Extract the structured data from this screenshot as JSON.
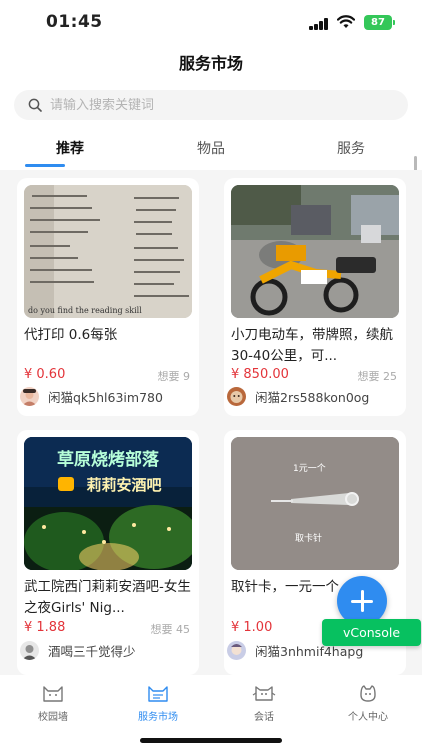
{
  "status_bar": {
    "time": "01:45",
    "battery": "87"
  },
  "header": {
    "title": "服务市场"
  },
  "search": {
    "placeholder": "请输入搜索关键词"
  },
  "tabs": [
    {
      "label": "推荐",
      "active": true
    },
    {
      "label": "物品",
      "active": false
    },
    {
      "label": "服务",
      "active": false
    }
  ],
  "items": [
    {
      "title": "代打印 0.6每张",
      "price": "¥ 0.60",
      "want": "想要 9",
      "seller": "闲猫qk5hl63im780"
    },
    {
      "title": "小刀电动车，带牌照，续航30-40公里，可...",
      "price": "¥ 850.00",
      "want": "想要 25",
      "seller": "闲猫2rs588kon0og"
    },
    {
      "title": "武工院西门莉莉安酒吧-女生之夜Girls' Nig...",
      "price": "¥ 1.88",
      "want": "想要 45",
      "seller": "酒喝三千觉得少"
    },
    {
      "title": "取针卡，一元一个",
      "price": "¥ 1.00",
      "want": "",
      "seller": "闲猫3nhmif4hapg"
    }
  ],
  "image_text": {
    "sign_line1": "草原烧烤部落",
    "sign_line2": "莉莉安酒吧",
    "photo_label1": "1元一个",
    "photo_label2": "取卡针",
    "book_question": "do you find the reading skill"
  },
  "fab": {
    "icon": "plus-icon"
  },
  "vconsole": {
    "label": "vConsole"
  },
  "bottom_nav": [
    {
      "label": "校园墙",
      "active": false
    },
    {
      "label": "服务市场",
      "active": true
    },
    {
      "label": "会话",
      "active": false
    },
    {
      "label": "个人中心",
      "active": false
    }
  ],
  "colors": {
    "accent": "#2f8cf0",
    "price": "#e3343a",
    "vconsole": "#07c160",
    "battery": "#34c759"
  }
}
